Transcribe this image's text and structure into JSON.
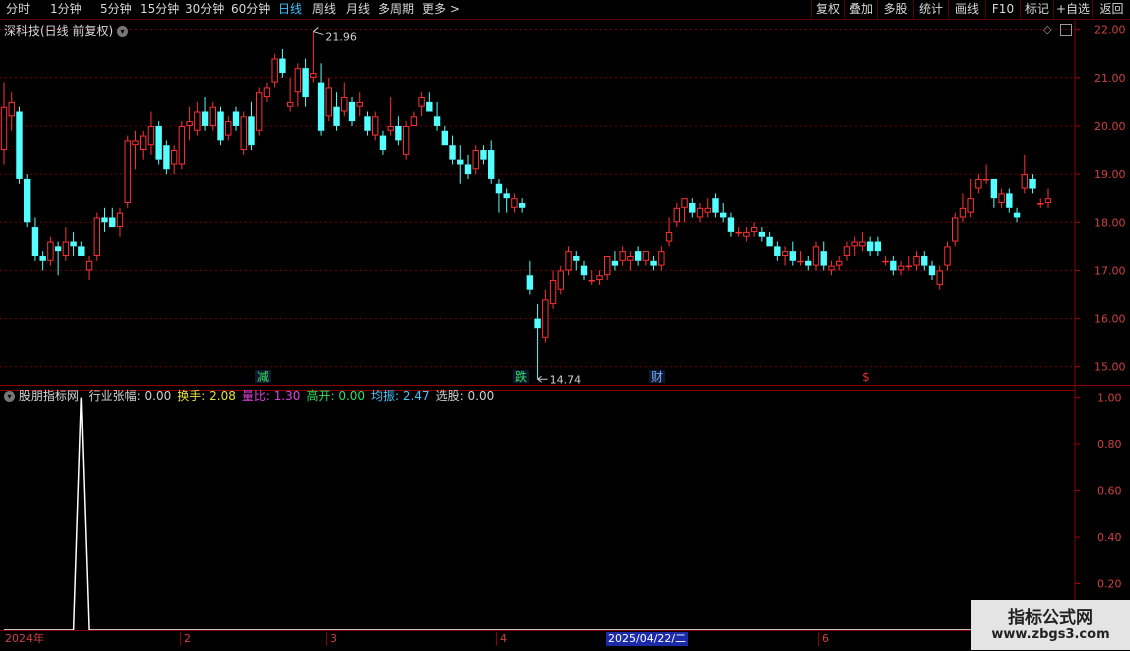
{
  "toolbar": {
    "periods": [
      "分时",
      "1分钟",
      "5分钟",
      "15分钟",
      "30分钟",
      "60分钟",
      "日线",
      "周线",
      "月线",
      "多周期",
      "更多"
    ],
    "active_period": "日线",
    "right_buttons": [
      "复权",
      "叠加",
      "多股",
      "统计",
      "画线",
      "F10",
      "标记",
      "+自选",
      "返回"
    ]
  },
  "main_chart": {
    "title": "深科技(日线 前复权)",
    "high_label": "21.96",
    "low_label": "14.74",
    "markers": [
      {
        "text": "减",
        "color": "#30e060"
      },
      {
        "text": "跌",
        "color": "#30e060"
      },
      {
        "text": "财",
        "color": "#6fb0ff"
      },
      {
        "text": "$",
        "color": "#e03030"
      }
    ],
    "y_axis_ticks": [
      "22.00",
      "21.00",
      "20.00",
      "19.00",
      "18.00",
      "17.00",
      "16.00",
      "15.00"
    ]
  },
  "indicator": {
    "name": "股朋指标网",
    "fields": [
      {
        "label": "行业张幅:",
        "value": "0.00",
        "color": "#d0d0d0"
      },
      {
        "label": "换手:",
        "value": "2.08",
        "color": "#e8e040"
      },
      {
        "label": "量比:",
        "value": "1.30",
        "color": "#e040e0"
      },
      {
        "label": "高开:",
        "value": "0.00",
        "color": "#30e060"
      },
      {
        "label": "均振:",
        "value": "2.47",
        "color": "#40c8ff"
      },
      {
        "label": "选股:",
        "value": "0.00",
        "color": "#d0d0d0"
      }
    ],
    "y_axis_ticks": [
      "1.00",
      "0.80",
      "0.60",
      "0.40",
      "0.20"
    ]
  },
  "time_axis": {
    "labels": [
      "2024年",
      "2",
      "3",
      "4",
      "6"
    ],
    "cursor_date": "2025/04/22/二"
  },
  "watermark": {
    "title": "指标公式网",
    "url": "www.zbgs3.com"
  },
  "chart_data": [
    {
      "type": "candlestick",
      "title": "深科技(日线 前复权)",
      "ylim": [
        14.6,
        22.2
      ],
      "candles": [
        {
          "o": 19.5,
          "h": 20.9,
          "l": 19.2,
          "c": 20.4
        },
        {
          "o": 20.2,
          "h": 20.7,
          "l": 19.9,
          "c": 20.5
        },
        {
          "o": 20.3,
          "h": 20.4,
          "l": 18.8,
          "c": 18.9
        },
        {
          "o": 18.9,
          "h": 19.0,
          "l": 17.9,
          "c": 18.0
        },
        {
          "o": 17.9,
          "h": 18.1,
          "l": 17.2,
          "c": 17.3
        },
        {
          "o": 17.3,
          "h": 17.4,
          "l": 17.0,
          "c": 17.2
        },
        {
          "o": 17.2,
          "h": 17.7,
          "l": 17.1,
          "c": 17.6
        },
        {
          "o": 17.5,
          "h": 17.6,
          "l": 16.9,
          "c": 17.4
        },
        {
          "o": 17.3,
          "h": 17.9,
          "l": 17.2,
          "c": 17.6
        },
        {
          "o": 17.6,
          "h": 17.8,
          "l": 17.3,
          "c": 17.5
        },
        {
          "o": 17.5,
          "h": 17.6,
          "l": 17.3,
          "c": 17.3
        },
        {
          "o": 17.0,
          "h": 17.3,
          "l": 16.8,
          "c": 17.2
        },
        {
          "o": 17.3,
          "h": 18.2,
          "l": 17.2,
          "c": 18.1
        },
        {
          "o": 18.1,
          "h": 18.3,
          "l": 17.8,
          "c": 18.0
        },
        {
          "o": 18.1,
          "h": 18.3,
          "l": 17.9,
          "c": 17.9
        },
        {
          "o": 17.9,
          "h": 18.3,
          "l": 17.7,
          "c": 18.2
        },
        {
          "o": 18.4,
          "h": 19.8,
          "l": 18.3,
          "c": 19.7
        },
        {
          "o": 19.6,
          "h": 19.9,
          "l": 19.1,
          "c": 19.7
        },
        {
          "o": 19.5,
          "h": 19.9,
          "l": 19.3,
          "c": 19.8
        },
        {
          "o": 19.6,
          "h": 20.3,
          "l": 19.4,
          "c": 20.0
        },
        {
          "o": 20.0,
          "h": 20.1,
          "l": 19.2,
          "c": 19.3
        },
        {
          "o": 19.6,
          "h": 19.7,
          "l": 19.0,
          "c": 19.1
        },
        {
          "o": 19.2,
          "h": 19.6,
          "l": 19.0,
          "c": 19.5
        },
        {
          "o": 19.2,
          "h": 20.1,
          "l": 19.1,
          "c": 20.0
        },
        {
          "o": 20.0,
          "h": 20.4,
          "l": 19.7,
          "c": 20.1
        },
        {
          "o": 19.9,
          "h": 20.5,
          "l": 19.8,
          "c": 20.3
        },
        {
          "o": 20.3,
          "h": 20.6,
          "l": 19.9,
          "c": 20.0
        },
        {
          "o": 20.0,
          "h": 20.5,
          "l": 19.9,
          "c": 20.4
        },
        {
          "o": 20.3,
          "h": 20.4,
          "l": 19.6,
          "c": 19.7
        },
        {
          "o": 19.8,
          "h": 20.2,
          "l": 19.7,
          "c": 20.1
        },
        {
          "o": 20.3,
          "h": 20.4,
          "l": 19.9,
          "c": 20.0
        },
        {
          "o": 19.5,
          "h": 20.3,
          "l": 19.4,
          "c": 20.2
        },
        {
          "o": 20.2,
          "h": 20.5,
          "l": 19.5,
          "c": 19.6
        },
        {
          "o": 19.9,
          "h": 20.8,
          "l": 19.8,
          "c": 20.7
        },
        {
          "o": 20.6,
          "h": 20.9,
          "l": 20.5,
          "c": 20.8
        },
        {
          "o": 20.9,
          "h": 21.5,
          "l": 20.8,
          "c": 21.4
        },
        {
          "o": 21.4,
          "h": 21.6,
          "l": 21.0,
          "c": 21.1
        },
        {
          "o": 20.4,
          "h": 21.0,
          "l": 20.3,
          "c": 20.5
        },
        {
          "o": 20.7,
          "h": 21.3,
          "l": 20.4,
          "c": 21.2
        },
        {
          "o": 21.2,
          "h": 21.4,
          "l": 20.4,
          "c": 20.6
        },
        {
          "o": 21.0,
          "h": 21.96,
          "l": 20.9,
          "c": 21.1
        },
        {
          "o": 20.9,
          "h": 21.3,
          "l": 19.8,
          "c": 19.9
        },
        {
          "o": 20.2,
          "h": 21.0,
          "l": 20.1,
          "c": 20.8
        },
        {
          "o": 20.4,
          "h": 20.7,
          "l": 19.9,
          "c": 20.0
        },
        {
          "o": 20.3,
          "h": 20.9,
          "l": 20.2,
          "c": 20.6
        },
        {
          "o": 20.5,
          "h": 20.6,
          "l": 20.0,
          "c": 20.1
        },
        {
          "o": 20.4,
          "h": 20.7,
          "l": 20.2,
          "c": 20.5
        },
        {
          "o": 20.2,
          "h": 20.3,
          "l": 19.8,
          "c": 19.9
        },
        {
          "o": 19.8,
          "h": 20.3,
          "l": 19.7,
          "c": 20.2
        },
        {
          "o": 19.8,
          "h": 19.9,
          "l": 19.4,
          "c": 19.5
        },
        {
          "o": 19.9,
          "h": 20.6,
          "l": 19.8,
          "c": 20.0
        },
        {
          "o": 20.0,
          "h": 20.2,
          "l": 19.6,
          "c": 19.7
        },
        {
          "o": 19.4,
          "h": 20.1,
          "l": 19.3,
          "c": 20.0
        },
        {
          "o": 20.0,
          "h": 20.3,
          "l": 20.1,
          "c": 20.2
        },
        {
          "o": 20.4,
          "h": 20.7,
          "l": 20.2,
          "c": 20.6
        },
        {
          "o": 20.5,
          "h": 20.7,
          "l": 20.3,
          "c": 20.3
        },
        {
          "o": 20.2,
          "h": 20.5,
          "l": 19.9,
          "c": 20.0
        },
        {
          "o": 19.9,
          "h": 20.0,
          "l": 19.6,
          "c": 19.6
        },
        {
          "o": 19.6,
          "h": 19.8,
          "l": 19.2,
          "c": 19.3
        },
        {
          "o": 19.3,
          "h": 19.6,
          "l": 18.8,
          "c": 19.2
        },
        {
          "o": 19.2,
          "h": 19.4,
          "l": 18.9,
          "c": 19.0
        },
        {
          "o": 19.1,
          "h": 19.6,
          "l": 19.0,
          "c": 19.5
        },
        {
          "o": 19.5,
          "h": 19.6,
          "l": 19.2,
          "c": 19.3
        },
        {
          "o": 19.5,
          "h": 19.7,
          "l": 18.8,
          "c": 18.9
        },
        {
          "o": 18.8,
          "h": 18.9,
          "l": 18.2,
          "c": 18.6
        },
        {
          "o": 18.6,
          "h": 18.7,
          "l": 18.2,
          "c": 18.5
        },
        {
          "o": 18.3,
          "h": 18.6,
          "l": 18.2,
          "c": 18.5
        },
        {
          "o": 18.4,
          "h": 18.5,
          "l": 18.2,
          "c": 18.3
        },
        {
          "o": 16.9,
          "h": 17.2,
          "l": 16.5,
          "c": 16.6
        },
        {
          "o": 16.0,
          "h": 16.3,
          "l": 14.74,
          "c": 15.8
        },
        {
          "o": 15.6,
          "h": 16.6,
          "l": 15.5,
          "c": 16.4
        },
        {
          "o": 16.3,
          "h": 17.0,
          "l": 16.2,
          "c": 16.8
        },
        {
          "o": 16.6,
          "h": 17.1,
          "l": 16.5,
          "c": 17.0
        },
        {
          "o": 17.0,
          "h": 17.5,
          "l": 16.9,
          "c": 17.4
        },
        {
          "o": 17.3,
          "h": 17.4,
          "l": 17.0,
          "c": 17.2
        },
        {
          "o": 17.1,
          "h": 17.2,
          "l": 16.8,
          "c": 16.9
        },
        {
          "o": 16.8,
          "h": 17.0,
          "l": 16.7,
          "c": 16.8
        },
        {
          "o": 16.8,
          "h": 17.0,
          "l": 16.7,
          "c": 16.9
        },
        {
          "o": 16.9,
          "h": 17.3,
          "l": 16.8,
          "c": 17.3
        },
        {
          "o": 17.2,
          "h": 17.4,
          "l": 17.0,
          "c": 17.1
        },
        {
          "o": 17.2,
          "h": 17.5,
          "l": 17.1,
          "c": 17.4
        },
        {
          "o": 17.2,
          "h": 17.4,
          "l": 17.0,
          "c": 17.3
        },
        {
          "o": 17.4,
          "h": 17.5,
          "l": 17.1,
          "c": 17.2
        },
        {
          "o": 17.2,
          "h": 17.4,
          "l": 17.1,
          "c": 17.4
        },
        {
          "o": 17.2,
          "h": 17.3,
          "l": 17.0,
          "c": 17.1
        },
        {
          "o": 17.1,
          "h": 17.5,
          "l": 17.0,
          "c": 17.4
        },
        {
          "o": 17.6,
          "h": 18.1,
          "l": 17.5,
          "c": 17.8
        },
        {
          "o": 18.0,
          "h": 18.4,
          "l": 17.9,
          "c": 18.3
        },
        {
          "o": 18.3,
          "h": 18.5,
          "l": 18.0,
          "c": 18.5
        },
        {
          "o": 18.4,
          "h": 18.5,
          "l": 18.1,
          "c": 18.2
        },
        {
          "o": 18.1,
          "h": 18.4,
          "l": 18.0,
          "c": 18.3
        },
        {
          "o": 18.2,
          "h": 18.5,
          "l": 18.1,
          "c": 18.3
        },
        {
          "o": 18.5,
          "h": 18.6,
          "l": 18.1,
          "c": 18.2
        },
        {
          "o": 18.2,
          "h": 18.4,
          "l": 18.0,
          "c": 18.1
        },
        {
          "o": 18.1,
          "h": 18.2,
          "l": 17.7,
          "c": 17.8
        },
        {
          "o": 17.8,
          "h": 17.9,
          "l": 17.7,
          "c": 17.8
        },
        {
          "o": 17.7,
          "h": 17.9,
          "l": 17.6,
          "c": 17.8
        },
        {
          "o": 17.8,
          "h": 18.0,
          "l": 17.7,
          "c": 17.9
        },
        {
          "o": 17.8,
          "h": 17.9,
          "l": 17.6,
          "c": 17.7
        },
        {
          "o": 17.7,
          "h": 17.8,
          "l": 17.5,
          "c": 17.5
        },
        {
          "o": 17.5,
          "h": 17.6,
          "l": 17.2,
          "c": 17.3
        },
        {
          "o": 17.3,
          "h": 17.5,
          "l": 17.1,
          "c": 17.4
        },
        {
          "o": 17.4,
          "h": 17.6,
          "l": 17.1,
          "c": 17.2
        },
        {
          "o": 17.2,
          "h": 17.4,
          "l": 17.1,
          "c": 17.2
        },
        {
          "o": 17.2,
          "h": 17.3,
          "l": 17.0,
          "c": 17.1
        },
        {
          "o": 17.1,
          "h": 17.6,
          "l": 17.0,
          "c": 17.5
        },
        {
          "o": 17.4,
          "h": 17.6,
          "l": 17.0,
          "c": 17.1
        },
        {
          "o": 17.0,
          "h": 17.2,
          "l": 16.9,
          "c": 17.1
        },
        {
          "o": 17.1,
          "h": 17.3,
          "l": 17.0,
          "c": 17.2
        },
        {
          "o": 17.3,
          "h": 17.6,
          "l": 17.2,
          "c": 17.5
        },
        {
          "o": 17.5,
          "h": 17.7,
          "l": 17.3,
          "c": 17.6
        },
        {
          "o": 17.5,
          "h": 17.8,
          "l": 17.4,
          "c": 17.6
        },
        {
          "o": 17.6,
          "h": 17.7,
          "l": 17.3,
          "c": 17.4
        },
        {
          "o": 17.6,
          "h": 17.7,
          "l": 17.3,
          "c": 17.4
        },
        {
          "o": 17.2,
          "h": 17.3,
          "l": 17.1,
          "c": 17.2
        },
        {
          "o": 17.2,
          "h": 17.3,
          "l": 16.9,
          "c": 17.0
        },
        {
          "o": 17.0,
          "h": 17.2,
          "l": 16.9,
          "c": 17.1
        },
        {
          "o": 17.1,
          "h": 17.3,
          "l": 17.0,
          "c": 17.1
        },
        {
          "o": 17.1,
          "h": 17.4,
          "l": 17.0,
          "c": 17.3
        },
        {
          "o": 17.3,
          "h": 17.4,
          "l": 17.0,
          "c": 17.1
        },
        {
          "o": 17.1,
          "h": 17.2,
          "l": 16.8,
          "c": 16.9
        },
        {
          "o": 16.7,
          "h": 17.1,
          "l": 16.6,
          "c": 17.0
        },
        {
          "o": 17.1,
          "h": 17.6,
          "l": 17.0,
          "c": 17.5
        },
        {
          "o": 17.6,
          "h": 18.2,
          "l": 17.5,
          "c": 18.1
        },
        {
          "o": 18.1,
          "h": 18.6,
          "l": 18.0,
          "c": 18.3
        },
        {
          "o": 18.2,
          "h": 18.9,
          "l": 18.1,
          "c": 18.5
        },
        {
          "o": 18.7,
          "h": 19.0,
          "l": 18.6,
          "c": 18.9
        },
        {
          "o": 18.9,
          "h": 19.2,
          "l": 18.8,
          "c": 18.9
        },
        {
          "o": 18.9,
          "h": 18.9,
          "l": 18.3,
          "c": 18.5
        },
        {
          "o": 18.4,
          "h": 18.7,
          "l": 18.3,
          "c": 18.6
        },
        {
          "o": 18.6,
          "h": 18.7,
          "l": 18.2,
          "c": 18.3
        },
        {
          "o": 18.2,
          "h": 18.3,
          "l": 18.0,
          "c": 18.1
        },
        {
          "o": 18.7,
          "h": 19.4,
          "l": 18.6,
          "c": 19.0
        },
        {
          "o": 18.9,
          "h": 19.0,
          "l": 18.6,
          "c": 18.7
        },
        {
          "o": 18.4,
          "h": 18.5,
          "l": 18.3,
          "c": 18.4
        },
        {
          "o": 18.4,
          "h": 18.7,
          "l": 18.3,
          "c": 18.5
        }
      ]
    },
    {
      "type": "line",
      "title": "股朋指标网",
      "ylim": [
        0,
        1.05
      ],
      "spike_index": 10,
      "spike_value": 1.0,
      "length": 135,
      "baseline": 0
    }
  ]
}
